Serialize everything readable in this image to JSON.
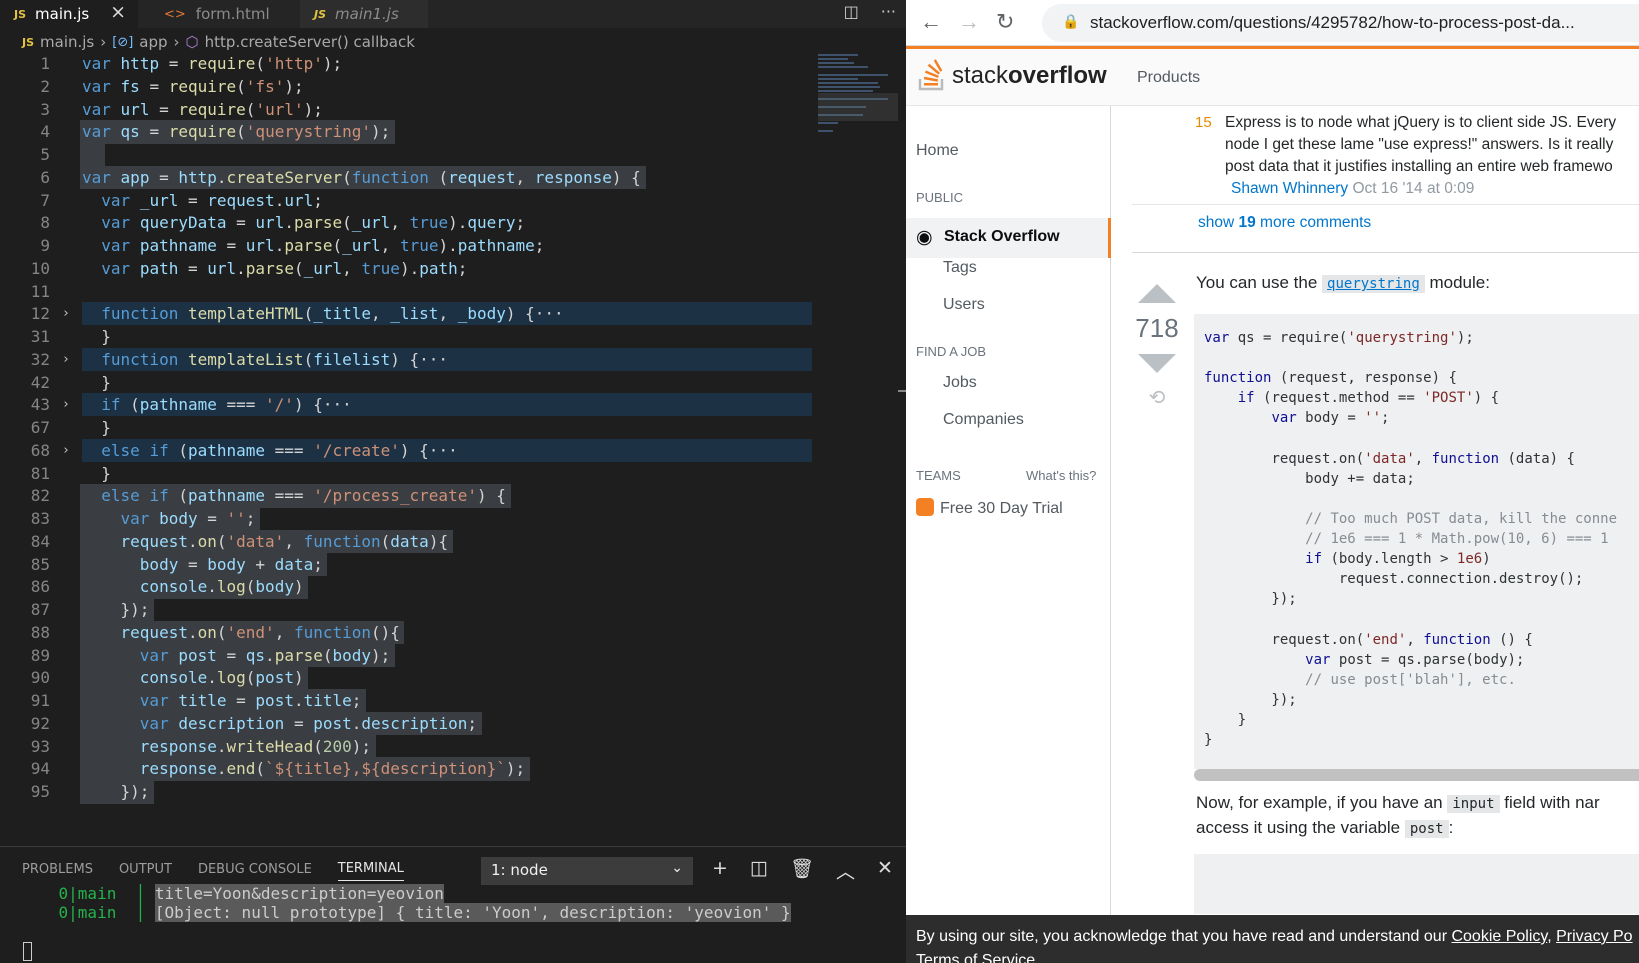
{
  "vscode": {
    "tabs": [
      {
        "label": "main.js",
        "icon": "JS",
        "active": true,
        "italic": false
      },
      {
        "label": "form.html",
        "icon": "<>",
        "active": false,
        "italic": false
      },
      {
        "label": "main1.js",
        "icon": "JS",
        "active": false,
        "italic": true
      }
    ],
    "tab_actions": [
      "split-editor-icon",
      "more-actions-icon"
    ],
    "breadcrumb": {
      "file": "main.js",
      "symbol1": "app",
      "symbol2": "http.createServer() callback"
    },
    "lines": [
      {
        "n": "1",
        "fold": false,
        "text": "var http = require('http');"
      },
      {
        "n": "2",
        "fold": false,
        "text": "var fs = require('fs');"
      },
      {
        "n": "3",
        "fold": false,
        "text": "var url = require('url');"
      },
      {
        "n": "4",
        "fold": false,
        "text": "var qs = require('querystring');"
      },
      {
        "n": "5",
        "fold": false,
        "text": ""
      },
      {
        "n": "6",
        "fold": false,
        "text": "var app = http.createServer(function (request, response) {"
      },
      {
        "n": "7",
        "fold": false,
        "text": "  var _url = request.url;"
      },
      {
        "n": "8",
        "fold": false,
        "text": "  var queryData = url.parse(_url, true).query;"
      },
      {
        "n": "9",
        "fold": false,
        "text": "  var pathname = url.parse(_url, true).pathname;"
      },
      {
        "n": "10",
        "fold": false,
        "text": "  var path = url.parse(_url, true).path;"
      },
      {
        "n": "11",
        "fold": false,
        "text": ""
      },
      {
        "n": "12",
        "fold": true,
        "text": "  function templateHTML(_title, _list, _body) {···"
      },
      {
        "n": "31",
        "fold": false,
        "text": "  }"
      },
      {
        "n": "32",
        "fold": true,
        "text": "  function templateList(filelist) {···"
      },
      {
        "n": "42",
        "fold": false,
        "text": "  }"
      },
      {
        "n": "43",
        "fold": true,
        "text": "  if (pathname === '/') {···"
      },
      {
        "n": "67",
        "fold": false,
        "text": "  }"
      },
      {
        "n": "68",
        "fold": true,
        "text": "  else if (pathname === '/create') {···"
      },
      {
        "n": "81",
        "fold": false,
        "text": "  }"
      },
      {
        "n": "82",
        "fold": false,
        "text": "  else if (pathname === '/process_create') {"
      },
      {
        "n": "83",
        "fold": false,
        "text": "    var body = '';"
      },
      {
        "n": "84",
        "fold": false,
        "text": "    request.on('data', function(data){"
      },
      {
        "n": "85",
        "fold": false,
        "text": "      body = body + data;"
      },
      {
        "n": "86",
        "fold": false,
        "text": "      console.log(body)"
      },
      {
        "n": "87",
        "fold": false,
        "text": "    });"
      },
      {
        "n": "88",
        "fold": false,
        "text": "    request.on('end', function(){"
      },
      {
        "n": "89",
        "fold": false,
        "text": "      var post = qs.parse(body);"
      },
      {
        "n": "90",
        "fold": false,
        "text": "      console.log(post)"
      },
      {
        "n": "91",
        "fold": false,
        "text": "      var title = post.title;"
      },
      {
        "n": "92",
        "fold": false,
        "text": "      var description = post.description;"
      },
      {
        "n": "93",
        "fold": false,
        "text": "      response.writeHead(200);"
      },
      {
        "n": "94",
        "fold": false,
        "text": "      response.end(`${title},${description}`);"
      },
      {
        "n": "95",
        "fold": false,
        "text": "    });"
      }
    ],
    "panel": {
      "tabs": [
        "PROBLEMS",
        "OUTPUT",
        "DEBUG CONSOLE",
        "TERMINAL"
      ],
      "active_tab": "TERMINAL",
      "terminal_select": "1: node",
      "terminal_lines": [
        {
          "prefix": "0|main",
          "text": "title=Yoon&description=yeovion"
        },
        {
          "prefix": "0|main",
          "text": "[Object: null prototype] { title: 'Yoon', description: 'yeovion' }"
        }
      ]
    }
  },
  "browser": {
    "url": "stackoverflow.com/questions/4295782/how-to-process-post-da...",
    "logo_light": "stack",
    "logo_bold": "overflow",
    "products": "Products",
    "nav": {
      "home": "Home",
      "public": "PUBLIC",
      "stack_overflow": "Stack Overflow",
      "tags": "Tags",
      "users": "Users",
      "find_a_job": "FIND A JOB",
      "jobs": "Jobs",
      "companies": "Companies",
      "teams": "TEAMS",
      "whats_this": "What's this?",
      "free_trial": "Free 30 Day Trial"
    },
    "comment": {
      "score": "15",
      "line1": "Express is to node what jQuery is to client side JS. Every",
      "line2": "node I get these lame \"use express!\" answers. Is it really",
      "line3": "post data that it justifies installing an entire web framewo",
      "author": "Shawn Whinnery",
      "date": "Oct 16 '14 at 0:09"
    },
    "show_more": {
      "prefix": "show ",
      "count": "19",
      "suffix": " more comments"
    },
    "answer": {
      "votes": "718",
      "intro_before": "You can use the ",
      "intro_code": "querystring",
      "intro_after": " module:",
      "code": [
        "var qs = require('querystring');",
        "",
        "function (request, response) {",
        "    if (request.method == 'POST') {",
        "        var body = '';",
        "",
        "        request.on('data', function (data) {",
        "            body += data;",
        "",
        "            // Too much POST data, kill the conne",
        "            // 1e6 === 1 * Math.pow(10, 6) === 1",
        "            if (body.length > 1e6)",
        "                request.connection.destroy();",
        "        });",
        "",
        "        request.on('end', function () {",
        "            var post = qs.parse(body);",
        "            // use post['blah'], etc.",
        "        });",
        "    }",
        "}"
      ],
      "after1_before": "Now, for example, if you have an ",
      "after1_code": "input",
      "after1_after": " field with nar",
      "after2_before": "access it using the variable ",
      "after2_code": "post",
      "after2_after": ":"
    },
    "cookie": {
      "text": "By using our site, you acknowledge that you have read and understand our ",
      "cookie_policy": "Cookie Policy",
      "sep": ", ",
      "privacy": "Privacy Po",
      "tos": "Terms of Service"
    }
  },
  "colors": {
    "keyword": "#569cd6",
    "string": "#ce9178",
    "function": "#dcdcaa",
    "so_orange": "#f48024",
    "link": "#0077cc"
  }
}
